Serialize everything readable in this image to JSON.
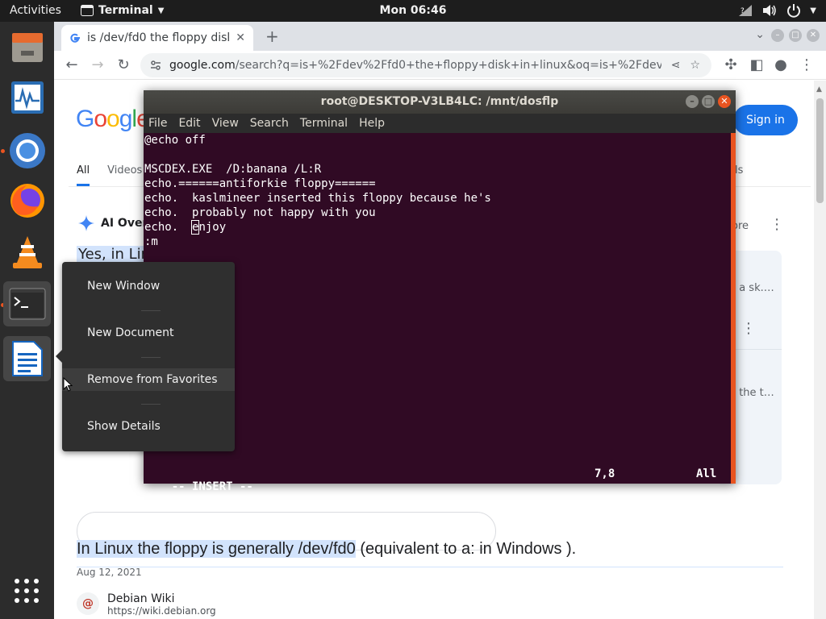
{
  "topbar": {
    "activities": "Activities",
    "app_name": "Terminal",
    "clock": "Mon 06:46"
  },
  "dock": {
    "items": [
      "files",
      "system-monitor",
      "chromium",
      "firefox",
      "vlc",
      "terminal",
      "libreoffice-writer"
    ],
    "apps_grid": "show-applications"
  },
  "browser": {
    "tab_title": "is /dev/fd0 the floppy disk",
    "url_host": "google.com",
    "url_path": "/search?q=is+%2Fdev%2Ffd0+the+floppy+disk+in+linux&oq=is+%2Fdev%2Ffd0+t..."
  },
  "google": {
    "logo": "Google",
    "signin": "Sign in",
    "tabs": [
      "All",
      "Videos"
    ],
    "tools": "ols",
    "ai_overview": "AI Overv",
    "more": "ore",
    "yes_line": "Yes, in Lin",
    "side_text_1": "at a sk.…",
    "side_text_2": "re the t…",
    "answer_highlight": "In Linux the floppy is generally /dev/fd0",
    "answer_rest": " (equivalent to a: in Windows ).",
    "answer_date": "Aug 12, 2021",
    "source_name": "Debian Wiki",
    "source_url": "https://wiki.debian.org"
  },
  "terminal": {
    "title": "root@DESKTOP-V3LB4LC: /mnt/dosflp",
    "menu": [
      "File",
      "Edit",
      "View",
      "Search",
      "Terminal",
      "Help"
    ],
    "lines": [
      "@echo off",
      "",
      "MSCDEX.EXE  /D:banana /L:R",
      "echo.======antiforkie floppy======",
      "echo.  kaslmineer inserted this floppy because he's",
      "echo.  probably not happy with you",
      "echo.  ",
      ":m"
    ],
    "cursor_line_prefix": "echo.  ",
    "cursor_char": "e",
    "cursor_line_suffix": "njoy",
    "tilde": "~",
    "mode": "-- INSERT --",
    "position": "7,8",
    "scroll": "All"
  },
  "context_menu": {
    "items": [
      "New Window",
      "New Document",
      "Remove from Favorites",
      "Show Details"
    ]
  },
  "colors": {
    "terminal_bg": "#300a24",
    "ubuntu_orange": "#e95420",
    "google_blue": "#1a73e8",
    "highlight": "#d2e3fc"
  }
}
